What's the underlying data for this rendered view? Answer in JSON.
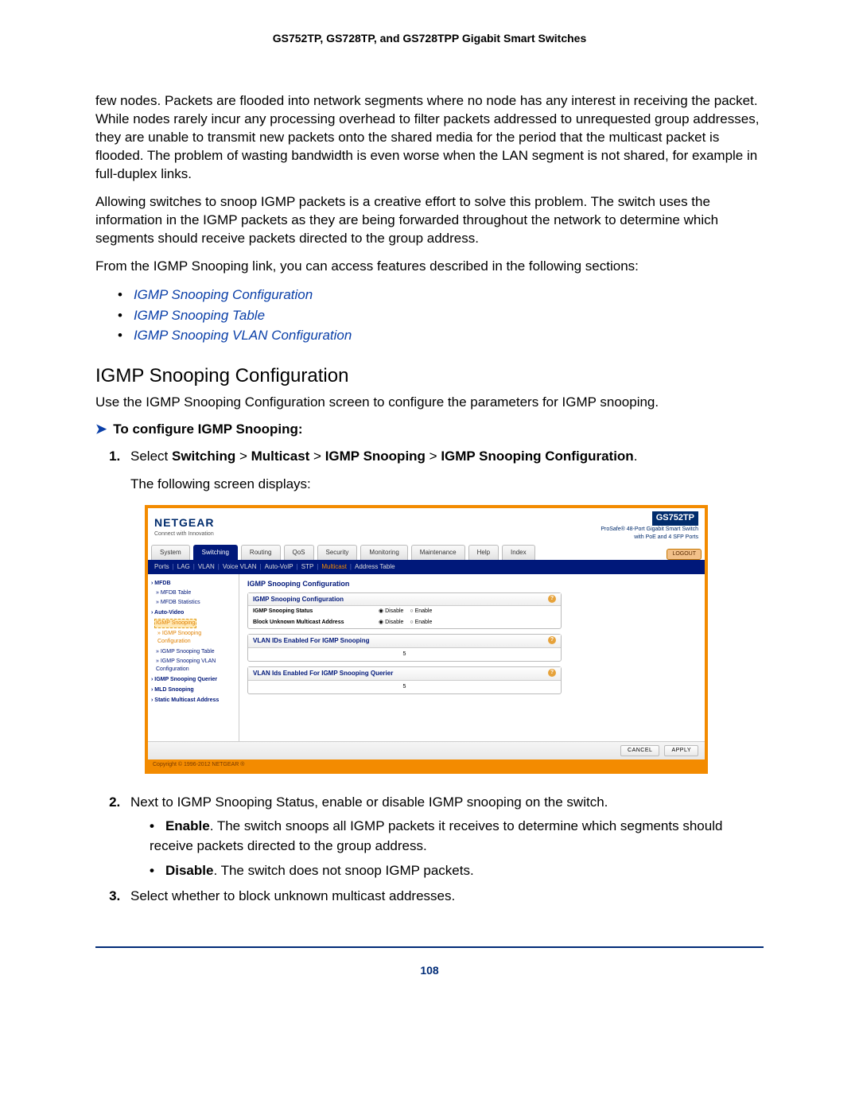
{
  "header": "GS752TP, GS728TP, and GS728TPP Gigabit Smart Switches",
  "paras": {
    "p1": "few nodes. Packets are flooded into network segments where no node has any interest in receiving the packet. While nodes rarely incur any processing overhead to filter packets addressed to unrequested group addresses, they are unable to transmit new packets onto the shared media for the period that the multicast packet is flooded. The problem of wasting bandwidth is even worse when the LAN segment is not shared, for example in full-duplex links.",
    "p2": "Allowing switches to snoop IGMP packets is a creative effort to solve this problem. The switch uses the information in the IGMP packets as they are being forwarded throughout the network to determine which segments should receive packets directed to the group address.",
    "p3": "From the IGMP Snooping link, you can access features described in the following sections:"
  },
  "links": [
    "IGMP Snooping Configuration",
    "IGMP Snooping Table",
    "IGMP Snooping VLAN Configuration"
  ],
  "section_heading": "IGMP Snooping Configuration",
  "section_intro": "Use the IGMP Snooping Configuration screen to configure the parameters for IGMP snooping.",
  "proc_head": "To configure IGMP Snooping:",
  "step1": {
    "lead": "Select ",
    "path": [
      "Switching",
      "Multicast",
      "IGMP Snooping",
      "IGMP Snooping Configuration"
    ],
    "trail": ".",
    "after": "The following screen displays:"
  },
  "step2": "Next to IGMP Snooping Status, enable or disable IGMP snooping on the switch.",
  "sub2": [
    {
      "b": "Enable",
      "t": ". The switch snoops all IGMP packets it receives to determine which segments should receive packets directed to the group address."
    },
    {
      "b": "Disable",
      "t": ". The switch does not snoop IGMP packets."
    }
  ],
  "step3": "Select whether to block unknown multicast addresses.",
  "ui": {
    "brand": "NETGEAR",
    "brand_tag": "Connect with Innovation",
    "model": "GS752TP",
    "model_sub": "ProSafe® 48-Port Gigabit Smart Switch\nwith PoE and 4 SFP Ports",
    "logout": "LOGOUT",
    "tabs": [
      "System",
      "Switching",
      "Routing",
      "QoS",
      "Security",
      "Monitoring",
      "Maintenance",
      "Help",
      "Index"
    ],
    "active_tab": "Switching",
    "subtabs": [
      "Ports",
      "LAG",
      "VLAN",
      "Voice VLAN",
      "Auto-VoIP",
      "STP",
      "Multicast",
      "Address Table"
    ],
    "subtab_hi": "Multicast",
    "side": {
      "groups": [
        {
          "hdr": "MFDB",
          "items": [
            "MFDB Table",
            "MFDB Statistics"
          ]
        },
        {
          "hdr": "Auto-Video",
          "items": []
        },
        {
          "sel2": "IGMP Snooping"
        },
        {
          "sel_items": [
            "IGMP Snooping Configuration",
            "IGMP Snooping Table",
            "IGMP Snooping VLAN Configuration"
          ]
        },
        {
          "hdr": "IGMP Snooping Querier",
          "items": []
        },
        {
          "hdr": "MLD Snooping",
          "items": []
        },
        {
          "hdr": "Static Multicast Address",
          "items": []
        }
      ]
    },
    "panel_title": "IGMP Snooping Configuration",
    "panel1": {
      "title": "IGMP Snooping Configuration",
      "rows": [
        {
          "label": "IGMP Snooping Status",
          "selected": "Disable",
          "other": "Enable"
        },
        {
          "label": "Block Unknown Multicast Address",
          "selected": "Disable",
          "other": "Enable"
        }
      ]
    },
    "panel2": {
      "title": "VLAN IDs Enabled For IGMP Snooping",
      "value": "5"
    },
    "panel3": {
      "title": "VLAN Ids Enabled For IGMP Snooping Querier",
      "value": "5"
    },
    "buttons": {
      "cancel": "CANCEL",
      "apply": "APPLY"
    },
    "copyright": "Copyright © 1996-2012 NETGEAR ®"
  },
  "page_num": "108"
}
